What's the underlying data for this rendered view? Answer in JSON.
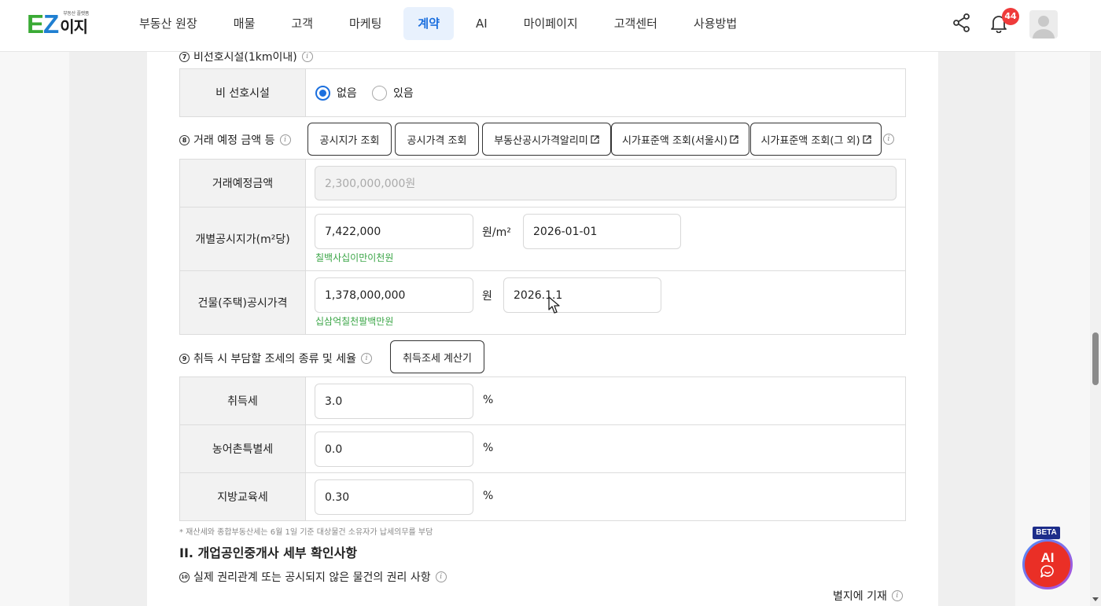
{
  "header": {
    "logo_ez": "EZ",
    "logo_kr": "이지",
    "logo_sub": "부동산 플랫폼",
    "nav": [
      {
        "label": "부동산 원장"
      },
      {
        "label": "매물"
      },
      {
        "label": "고객"
      },
      {
        "label": "마케팅"
      },
      {
        "label": "계약",
        "active": true
      },
      {
        "label": "AI"
      },
      {
        "label": "마이페이지"
      },
      {
        "label": "고객센터"
      },
      {
        "label": "사용방법"
      }
    ],
    "notification_count": "44",
    "icons": [
      "share-icon",
      "bell-icon",
      "avatar-icon"
    ]
  },
  "section7": {
    "number": "⑦",
    "title": "비선호시설(1km이내)",
    "row_label": "비 선호시설",
    "options": [
      {
        "label": "없음",
        "selected": true
      },
      {
        "label": "있음",
        "selected": false
      }
    ]
  },
  "section8": {
    "number": "⑧",
    "title": "거래 예정 금액 등",
    "buttons": [
      {
        "label": "공시지가 조회",
        "external": false
      },
      {
        "label": "공시가격 조회",
        "external": false
      },
      {
        "label": "부동산공시가격알리미",
        "external": true
      },
      {
        "label": "시가표준액 조회(서울시)",
        "external": true
      },
      {
        "label": "시가표준액 조회(그 외)",
        "external": true
      }
    ],
    "rows": {
      "planned_amount": {
        "label": "거래예정금액",
        "value": "2,300,000,000원"
      },
      "land_price": {
        "label": "개별공시지가(m²당)",
        "value": "7,422,000",
        "unit": "원/m²",
        "date": "2026-01-01",
        "hangul": "칠백사십이만이천원"
      },
      "building_price": {
        "label": "건물(주택)공시가격",
        "value": "1,378,000,000",
        "unit": "원",
        "date": "2026.1.1",
        "hangul": "십삼억칠천팔백만원"
      }
    }
  },
  "section9": {
    "number": "⑨",
    "title": "취득 시 부담할 조세의 종류 및 세율",
    "calc_button": "취득조세 계산기",
    "rows": [
      {
        "label": "취득세",
        "value": "3.0",
        "unit": "%"
      },
      {
        "label": "농어촌특별세",
        "value": "0.0",
        "unit": "%"
      },
      {
        "label": "지방교육세",
        "value": "0.30",
        "unit": "%"
      }
    ],
    "note": "* 재산세와 종합부동산세는 6월 1일 기준 대상물건 소유자가 납세의무를 부담"
  },
  "section2": {
    "title": "II. 개업공인중개사 세부 확인사항"
  },
  "section10": {
    "number": "⑩",
    "title": "실제 권리관계 또는 공시되지 않은 물건의 권리 사항",
    "attach_label": "별지에 기재"
  },
  "ai_widget": {
    "badge": "BETA",
    "label": "AI"
  },
  "colors": {
    "accent": "#1b6fde",
    "hint_green": "#3aa546",
    "badge_red": "#ef3b3b",
    "ai_red": "#ea2f26",
    "beta_navy": "#1d2d8a"
  }
}
